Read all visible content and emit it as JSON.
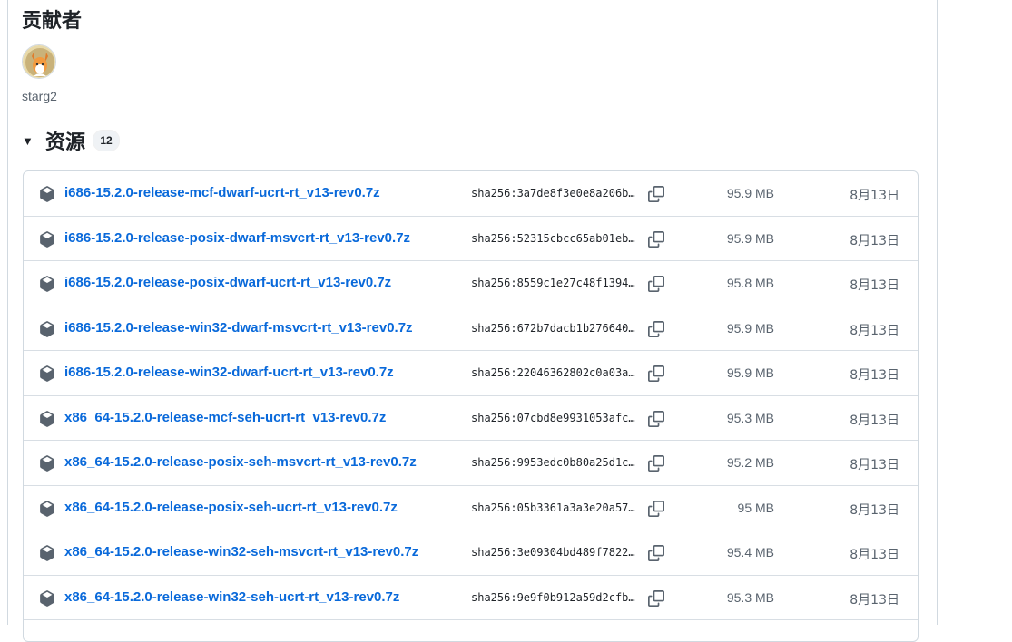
{
  "contributors": {
    "title": "贡献者",
    "name": "starg2"
  },
  "assets": {
    "title": "资源",
    "count": "12",
    "items": [
      {
        "name": "i686-15.2.0-release-mcf-dwarf-ucrt-rt_v13-rev0.7z",
        "sha": "sha256:3a7de8f3e0e8a206b…",
        "size": "95.9 MB",
        "date": "8月13日"
      },
      {
        "name": "i686-15.2.0-release-posix-dwarf-msvcrt-rt_v13-rev0.7z",
        "sha": "sha256:52315cbcc65ab01eb…",
        "size": "95.9 MB",
        "date": "8月13日"
      },
      {
        "name": "i686-15.2.0-release-posix-dwarf-ucrt-rt_v13-rev0.7z",
        "sha": "sha256:8559c1e27c48f1394…",
        "size": "95.8 MB",
        "date": "8月13日"
      },
      {
        "name": "i686-15.2.0-release-win32-dwarf-msvcrt-rt_v13-rev0.7z",
        "sha": "sha256:672b7dacb1b276640…",
        "size": "95.9 MB",
        "date": "8月13日"
      },
      {
        "name": "i686-15.2.0-release-win32-dwarf-ucrt-rt_v13-rev0.7z",
        "sha": "sha256:22046362802c0a03a…",
        "size": "95.9 MB",
        "date": "8月13日"
      },
      {
        "name": "x86_64-15.2.0-release-mcf-seh-ucrt-rt_v13-rev0.7z",
        "sha": "sha256:07cbd8e9931053afc…",
        "size": "95.3 MB",
        "date": "8月13日"
      },
      {
        "name": "x86_64-15.2.0-release-posix-seh-msvcrt-rt_v13-rev0.7z",
        "sha": "sha256:9953edc0b80a25d1c…",
        "size": "95.2 MB",
        "date": "8月13日"
      },
      {
        "name": "x86_64-15.2.0-release-posix-seh-ucrt-rt_v13-rev0.7z",
        "sha": "sha256:05b3361a3a3e20a57…",
        "size": "95 MB",
        "date": "8月13日"
      },
      {
        "name": "x86_64-15.2.0-release-win32-seh-msvcrt-rt_v13-rev0.7z",
        "sha": "sha256:3e09304bd489f7822…",
        "size": "95.4 MB",
        "date": "8月13日"
      },
      {
        "name": "x86_64-15.2.0-release-win32-seh-ucrt-rt_v13-rev0.7z",
        "sha": "sha256:9e9f0b912a59d2cfb…",
        "size": "95.3 MB",
        "date": "8月13日"
      }
    ]
  },
  "colors": {
    "link": "#0969da",
    "muted": "#59636e",
    "border": "#d1d9e0"
  },
  "icons": {
    "asset": "package-icon",
    "copy": "copy-icon",
    "toggle": "triangle-down-icon"
  }
}
